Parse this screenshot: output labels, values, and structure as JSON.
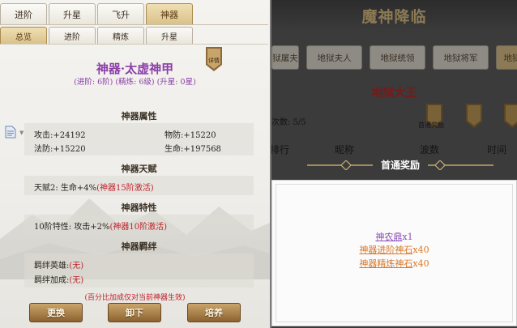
{
  "left": {
    "tabs_top": [
      "进阶",
      "升星",
      "飞升",
      "神器"
    ],
    "tabs_sub": [
      "总览",
      "进阶",
      "精炼",
      "升星"
    ],
    "title": "神器·太虚神甲",
    "subtitle": "(进阶: 6阶) (精炼: 6级) (升星: 0星)",
    "badge_text": "详情",
    "sections": {
      "attributes": {
        "heading": "神器属性",
        "stats": [
          {
            "label": "攻击:+24192"
          },
          {
            "label": "物防:+15220"
          },
          {
            "label": "法防:+15220"
          },
          {
            "label": "生命:+197568"
          }
        ]
      },
      "talent": {
        "heading": "神器天赋",
        "line": "天赋2: 生命+4%",
        "tag": "(神器15阶激活)"
      },
      "trait": {
        "heading": "神器特性",
        "line": "10阶特性: 攻击+2%",
        "tag": "(神器10阶激活)"
      },
      "bond": {
        "heading": "神器羁绊",
        "hero_label": "羁绊英雄:",
        "hero_value": "(无)",
        "bonus_label": "羁绊加成:",
        "bonus_value": "(无)"
      }
    },
    "note": "(百分比加成仅对当前神器生效)",
    "buttons": {
      "replace": "更换",
      "unload": "卸下",
      "upgrade": "培养"
    }
  },
  "right": {
    "title": "魔神降临",
    "tabs": [
      "狱屠夫",
      "地狱夫人",
      "地狱统领",
      "地狱将军",
      "地狱"
    ],
    "boss_name": "地狱大王",
    "count_text": "次数: 5/5",
    "icon_label_first": "首通奖励",
    "columns": [
      "排行",
      "昵称",
      "波数",
      "时间"
    ],
    "popup_title": "首通奖励",
    "rewards": [
      {
        "name": "神农鼎",
        "qty": "x1",
        "color": "#8b4fb8"
      },
      {
        "name": "神器进阶神石",
        "qty": "x40",
        "color": "#d8782a"
      },
      {
        "name": "神器精炼神石",
        "qty": "x40",
        "color": "#d8782a"
      }
    ]
  }
}
